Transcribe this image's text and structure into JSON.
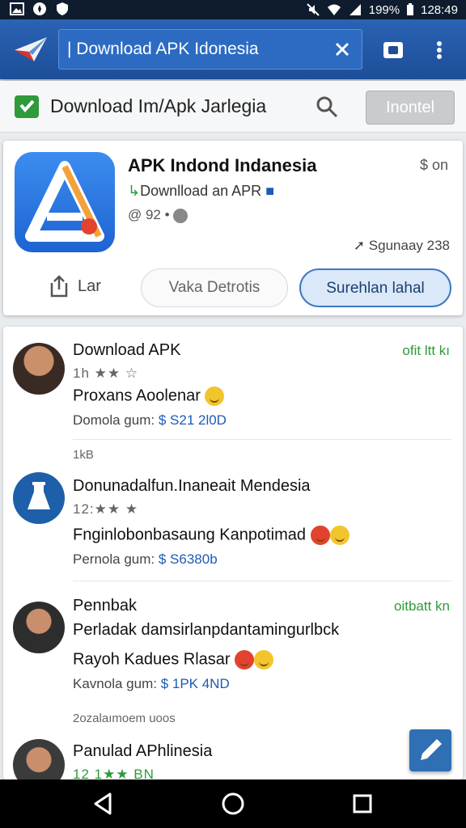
{
  "status_bar": {
    "battery": "199%",
    "time": "128:49"
  },
  "toolbar": {
    "url": "| Download APK Idonesia"
  },
  "search_row": {
    "query": "Download Im/Apk Jarlegia",
    "install_label": "Inontel"
  },
  "app": {
    "title": "APK Indond Indanesia",
    "developer": "Downlload an APR",
    "meta": "@ 92",
    "badge": "on",
    "date": "Sgunaay 238",
    "share_label": "Lar",
    "secondary_label": "Vaka Detrotis",
    "primary_label": "Surehlan lahal"
  },
  "list": {
    "items": [
      {
        "title": "Download APK",
        "right": "ofit ltt kı",
        "stars": "1h ★★ ☆",
        "desc": "Proxans Aoolenar",
        "foot_label": "Domola gum:",
        "price": "$ S21 2l0D"
      },
      {
        "sub": "1kB"
      },
      {
        "title": "Donunadalfun.Inaneait Mendesia",
        "stars": "12:★★ ★",
        "desc": "Fnginlobonbasaung Kanpotimad",
        "foot_label": "Pernola gum:",
        "price": "$ S6380b"
      },
      {
        "title": "Pennbak",
        "right": "oitbatt kn",
        "desc": "Perladak damsirlanpdantamingurlbck",
        "desc2": "Rayoh Kadues Rlasar",
        "foot_label": "Kavnola gum:",
        "price": "$ 1PK 4ND"
      },
      {
        "sub": "2ozalaımoem uoos"
      },
      {
        "title": "Panulad APhlinesia",
        "stars": "12 1★★ BN"
      }
    ]
  }
}
